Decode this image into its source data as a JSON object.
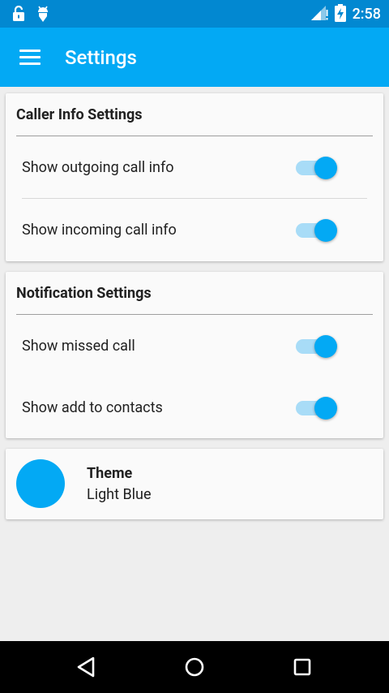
{
  "status_bar": {
    "time": "2:58"
  },
  "app_bar": {
    "title": "Settings"
  },
  "caller_info": {
    "header": "Caller Info Settings",
    "items": [
      {
        "label": "Show outgoing call info",
        "enabled": true
      },
      {
        "label": "Show incoming call info",
        "enabled": true
      }
    ]
  },
  "notification": {
    "header": "Notification Settings",
    "items": [
      {
        "label": "Show missed call",
        "enabled": true
      },
      {
        "label": "Show add to contacts",
        "enabled": true
      }
    ]
  },
  "theme": {
    "title": "Theme",
    "value": "Light Blue",
    "color": "#03a9f4"
  },
  "colors": {
    "primary": "#03a9f4",
    "status_bar": "#0288d1",
    "switch_track": "#a8dcf7"
  },
  "icons": {
    "status_left": [
      "lock-icon",
      "android-debug-icon"
    ],
    "status_right": [
      "signal-icon",
      "battery-charging-icon"
    ],
    "nav": [
      "back-icon",
      "home-icon",
      "recents-icon"
    ]
  }
}
